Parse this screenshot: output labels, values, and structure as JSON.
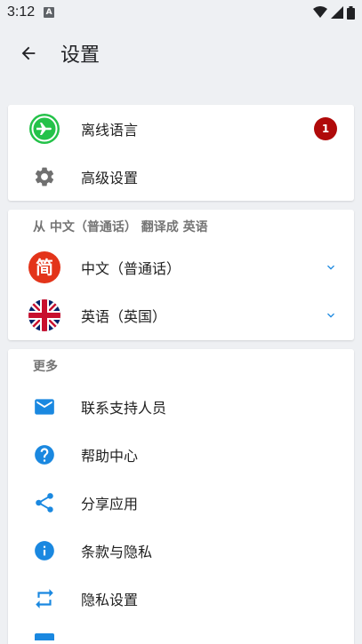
{
  "status_bar": {
    "time": "3:12",
    "notif_letter": "A"
  },
  "app_bar": {
    "title": "设置"
  },
  "card1": {
    "offline": {
      "label": "离线语言",
      "badge": "1",
      "badge_color": "#b00a0a",
      "icon_color": "#24c249"
    },
    "advanced": {
      "label": "高级设置"
    }
  },
  "card2": {
    "header": "从 中文（普通话） 翻译成 英语",
    "source": {
      "label": "中文（普通话）",
      "flag_char": "简"
    },
    "target": {
      "label": "英语（英国）"
    }
  },
  "card3": {
    "header": "更多",
    "items": [
      {
        "label": "联系支持人员",
        "icon": "mail-icon"
      },
      {
        "label": "帮助中心",
        "icon": "help-icon"
      },
      {
        "label": "分享应用",
        "icon": "share-icon"
      },
      {
        "label": "条款与隐私",
        "icon": "info-icon"
      },
      {
        "label": "隐私设置",
        "icon": "repeat-icon"
      }
    ]
  },
  "colors": {
    "accent": "#1a88e0",
    "background": "#eef0f3"
  }
}
